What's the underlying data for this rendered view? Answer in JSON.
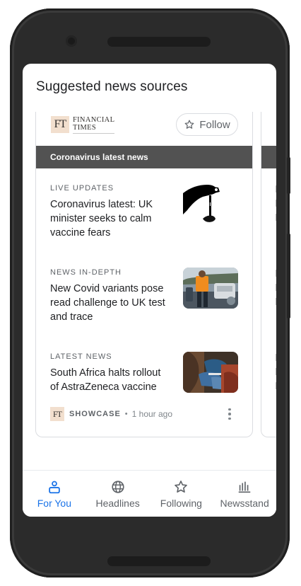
{
  "page": {
    "title": "Suggested news sources"
  },
  "source_card": {
    "publisher": {
      "abbrev": "FT",
      "name_line1": "Financial",
      "name_line2": "Times"
    },
    "follow_label": "Follow",
    "section_title": "Coronavirus latest news",
    "articles": [
      {
        "kicker": "Live updates",
        "headline": "Coronavirus latest: UK minister seeks to calm vaccine fears",
        "thumb_icon": "vaccine-drop-image"
      },
      {
        "kicker": "News in-depth",
        "headline": "New Covid variants pose read challenge to UK test and trace",
        "thumb_icon": "test-and-trace-photo"
      },
      {
        "kicker": "Latest news",
        "headline": "South Africa halts rollout of AstraZeneca vaccine",
        "thumb_icon": "vaccination-photo"
      }
    ],
    "footer": {
      "abbrev": "FT",
      "label": "SHOWCASE",
      "separator": "•",
      "time": "1 hour ago"
    }
  },
  "bottom_nav": {
    "items": [
      {
        "label": "For You",
        "icon": "for-you-icon",
        "active": true
      },
      {
        "label": "Headlines",
        "icon": "globe-icon",
        "active": false
      },
      {
        "label": "Following",
        "icon": "star-icon",
        "active": false
      },
      {
        "label": "Newsstand",
        "icon": "newsstand-icon",
        "active": false
      }
    ]
  },
  "colors": {
    "accent": "#1a73e8",
    "section_bar": "#525252",
    "text_primary": "#202124",
    "text_secondary": "#5f6368",
    "ft_pink": "#f2dfce"
  }
}
